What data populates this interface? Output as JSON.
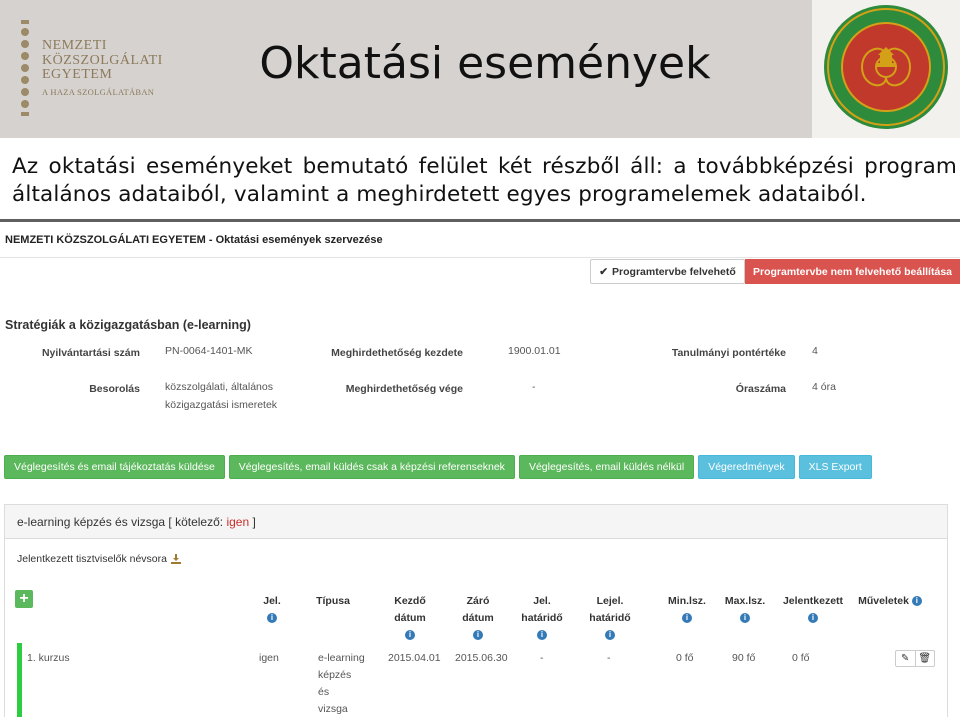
{
  "slide": {
    "title": "Oktatási események",
    "intro_text": "Az oktatási eseményeket bemutató felület két részből áll: a továbbképzési program általános adataiból, valamint a meghirdetett egyes programelemek adataiból.",
    "logo_left": {
      "line1": "NEMZETI",
      "line2": "KÖZSZOLGÁLATI",
      "line3": "EGYETEM",
      "line4": "A HAZA SZOLGÁLATÁBAN"
    },
    "seal": {
      "icon": "university-seal-icon",
      "colors": {
        "outer": "#2e8b3c",
        "inner": "#c0392b",
        "gold": "#d4a017"
      }
    }
  },
  "app": {
    "header_title": "NEMZETI KÖZSZOLGÁLATI EGYETEM - Oktatási események szervezése",
    "btn_in_program": "Programtervbe felvehető",
    "btn_not_in_program": "Programtervbe nem felvehető beállítása",
    "program_name": "Stratégiák a közigazgatásban (e-learning)",
    "fields": {
      "reg_no_label": "Nyilvántartási szám",
      "reg_no_value": "PN-0064-1401-MK",
      "start_label": "Meghirdethetőség kezdete",
      "start_value": "1900.01.01",
      "credits_label": "Tanulmányi pontértéke",
      "credits_value": "4",
      "class_label": "Besorolás",
      "class_value_1": "közszolgálati, általános",
      "class_value_2": "közigazgatási ismeretek",
      "end_label": "Meghirdethetőség vége",
      "end_value": "-",
      "hours_label": "Óraszáma",
      "hours_value": "4 óra"
    },
    "actions": [
      "Véglegesítés és email tájékoztatás küldése",
      "Véglegesítés, email küldés csak a képzési referenseknek",
      "Véglegesítés, email küldés nélkül",
      "Végeredmények",
      "XLS Export"
    ],
    "panel": {
      "title_prefix": "e-learning képzés és vizsga [ kötelező: ",
      "title_value": "igen",
      "title_suffix": " ]",
      "list_title": "Jelentkezett tisztviselők névsora",
      "columns": {
        "jel": "Jel.",
        "type": "Típusa",
        "start_1": "Kezdő",
        "start_2": "dátum",
        "end_1": "Záró",
        "end_2": "dátum",
        "jel_deadline_1": "Jel.",
        "jel_deadline_2": "határidő",
        "unreg_1": "Lejel.",
        "unreg_2": "határidő",
        "min": "Min.lsz.",
        "max": "Max.lsz.",
        "registered": "Jelentkezett",
        "ops": "Műveletek"
      },
      "row": {
        "name": "1. kurzus",
        "jel": "igen",
        "type_1": "e-learning",
        "type_2": "képzés",
        "type_3": "és",
        "type_4": "vizsga",
        "start": "2015.04.01",
        "end": "2015.06.30",
        "jel_deadline": "-",
        "unreg_deadline": "-",
        "min": "0 fő",
        "max": "90 fő",
        "registered": "0 fő"
      }
    }
  }
}
